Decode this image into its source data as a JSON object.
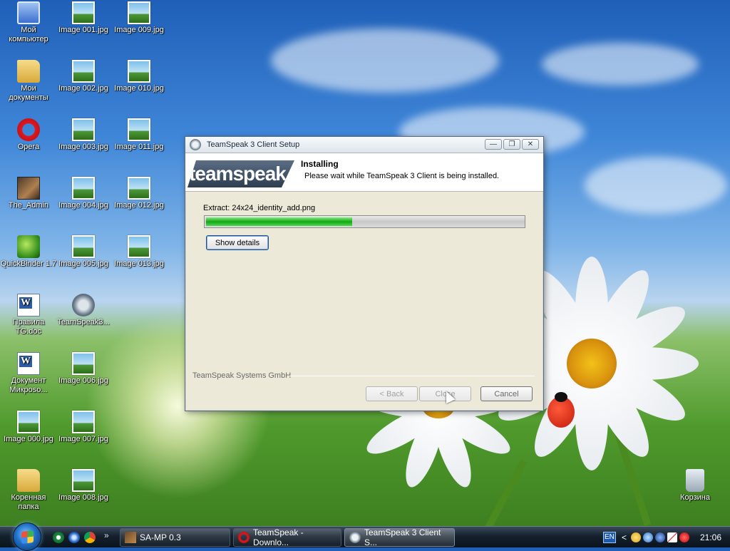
{
  "desktop_icons": [
    {
      "label": "Мой компьютер",
      "icon": "computer-icon"
    },
    {
      "label": "Мои документы",
      "icon": "folder-icon"
    },
    {
      "label": "Opera",
      "icon": "opera-icon"
    },
    {
      "label": "The_Admin",
      "icon": "avatar-icon"
    },
    {
      "label": "QuickBinder 1.7",
      "icon": "quickbinder-icon"
    },
    {
      "label": "Правила TG.doc",
      "icon": "word-doc-icon"
    },
    {
      "label": "Документ Микрoso...",
      "icon": "word-doc-icon"
    },
    {
      "label": "Image 000.jpg",
      "icon": "image-icon"
    },
    {
      "label": "Коренная папка",
      "icon": "folder-icon"
    },
    {
      "label": "Image 001.jpg",
      "icon": "image-icon"
    },
    {
      "label": "Image 002.jpg",
      "icon": "image-icon"
    },
    {
      "label": "Image 003.jpg",
      "icon": "image-icon"
    },
    {
      "label": "Image 004.jpg",
      "icon": "image-icon"
    },
    {
      "label": "Image 005.jpg",
      "icon": "image-icon"
    },
    {
      "label": "TeamSpeak3...",
      "icon": "teamspeak-icon"
    },
    {
      "label": "Image 006.jpg",
      "icon": "image-icon"
    },
    {
      "label": "Image 007.jpg",
      "icon": "image-icon"
    },
    {
      "label": "Image 008.jpg",
      "icon": "image-icon"
    },
    {
      "label": "Image 009.jpg",
      "icon": "image-icon"
    },
    {
      "label": "Image 010.jpg",
      "icon": "image-icon"
    },
    {
      "label": "Image 011.jpg",
      "icon": "image-icon"
    },
    {
      "label": "Image 012.jpg",
      "icon": "image-icon"
    },
    {
      "label": "Image 013.jpg",
      "icon": "image-icon"
    },
    {
      "label": "Корзина",
      "icon": "recycle-bin-icon"
    }
  ],
  "dialog": {
    "title": "TeamSpeak 3 Client Setup",
    "logo_text": "teamspeak",
    "header_title": "Installing",
    "header_subtitle": "Please wait while TeamSpeak 3 Client is being installed.",
    "extract_text": "Extract: 24x24_identity_add.png",
    "progress": 0.46,
    "show_details_label": "Show details",
    "brand_text": "TeamSpeak Systems GmbH",
    "back_label": "< Back",
    "close_label": "Close",
    "cancel_label": "Cancel",
    "min_glyph": "—",
    "max_glyph": "❐",
    "close_glyph": "✕"
  },
  "taskbar": {
    "tasks": [
      {
        "label": "SA-MP 0.3",
        "icon": "samp-icon"
      },
      {
        "label": "TeamSpeak - Downlo...",
        "icon": "opera-icon"
      },
      {
        "label": "TeamSpeak 3 Client S...",
        "icon": "teamspeak-icon"
      }
    ],
    "quicklaunch_more": "»",
    "language": "EN",
    "tray_arrow": "<",
    "clock": "21:06"
  },
  "colors": {
    "progress_fill": "#16a616",
    "taskbar": "#14202c",
    "dialog_bg": "#ece9d8"
  }
}
